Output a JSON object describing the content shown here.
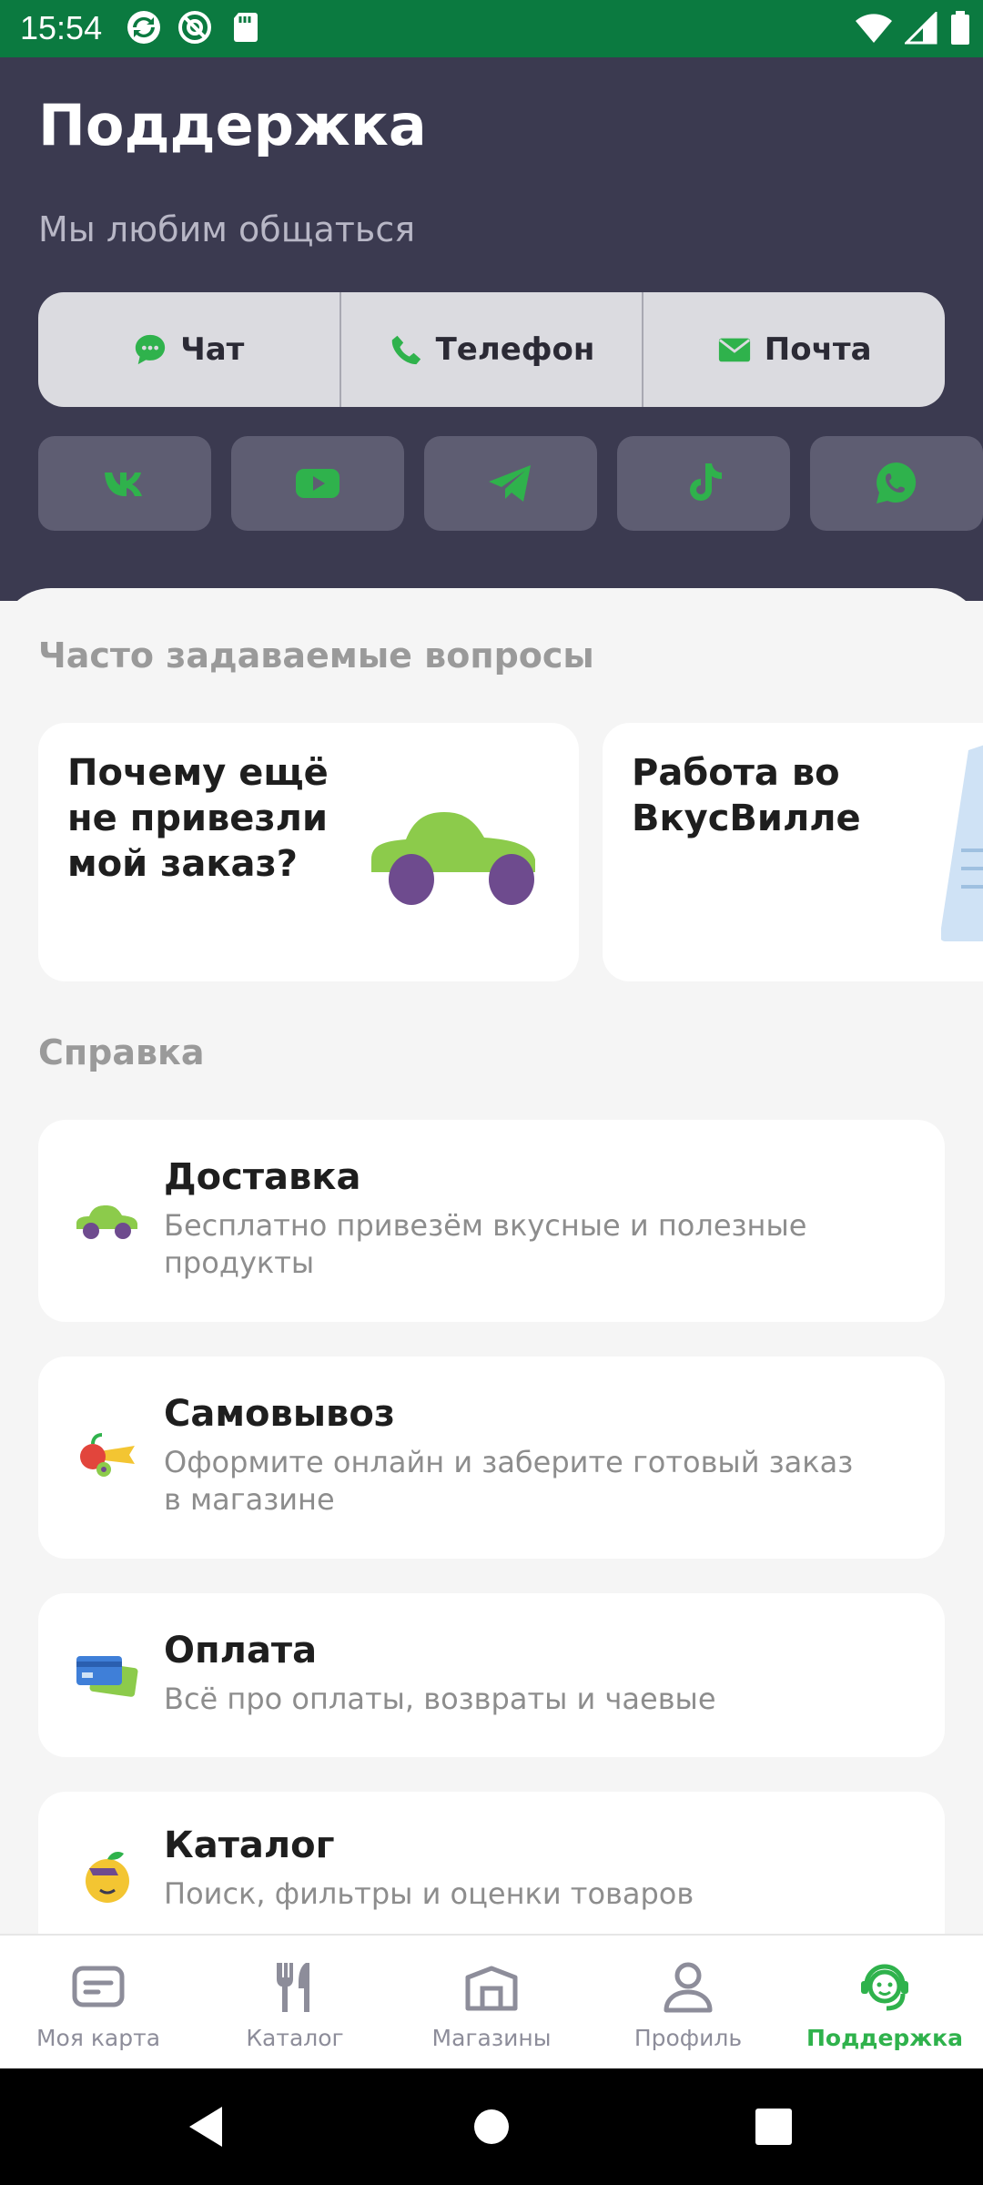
{
  "status_bar": {
    "time": "15:54"
  },
  "header": {
    "title": "Поддержка",
    "subtitle": "Мы любим общаться",
    "contact_options": [
      {
        "label": "Чат",
        "icon": "chat-icon"
      },
      {
        "label": "Телефон",
        "icon": "phone-icon"
      },
      {
        "label": "Почта",
        "icon": "mail-icon"
      }
    ],
    "socials": [
      "vk-icon",
      "youtube-icon",
      "telegram-icon",
      "tiktok-icon",
      "whatsapp-icon"
    ]
  },
  "faq": {
    "title": "Часто задаваемые вопросы",
    "cards": [
      {
        "question": "Почему ещё не привезли мой заказ?"
      },
      {
        "question": "Работа во ВкусВилле"
      }
    ]
  },
  "help": {
    "title": "Справка",
    "items": [
      {
        "title": "Доставка",
        "description": "Бесплатно привезём вкусные и полезные продукты",
        "icon": "car-icon"
      },
      {
        "title": "Самовывоз",
        "description": "Оформите онлайн и заберите готовый заказ в магазине",
        "icon": "fruit-icon"
      },
      {
        "title": "Оплата",
        "description": "Всё про оплаты, возвраты и чаевые",
        "icon": "payment-card-icon"
      },
      {
        "title": "Каталог",
        "description": "Поиск, фильтры и оценки товаров",
        "icon": "lemon-icon"
      }
    ]
  },
  "bottom_nav": [
    {
      "label": "Моя карта",
      "icon": "card-icon",
      "active": false
    },
    {
      "label": "Каталог",
      "icon": "fork-knife-icon",
      "active": false
    },
    {
      "label": "Магазины",
      "icon": "store-icon",
      "active": false
    },
    {
      "label": "Профиль",
      "icon": "profile-icon",
      "active": false
    },
    {
      "label": "Поддержка",
      "icon": "support-icon",
      "active": true
    }
  ],
  "colors": {
    "header_bg": "#3b3a50",
    "status_bg": "#0b7a40",
    "accent": "#2fb24c"
  }
}
